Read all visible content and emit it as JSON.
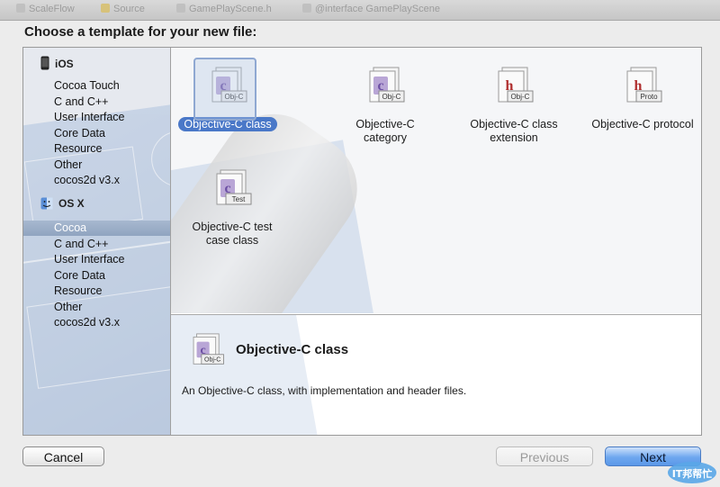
{
  "window": {
    "background_tabs": [
      "ScaleFlow",
      "Source",
      "GamePlayScene.h",
      "@interface GamePlayScene"
    ]
  },
  "heading": "Choose a template for your new file:",
  "sidebar": {
    "sections": [
      {
        "title": "iOS",
        "icon": "iphone-icon",
        "items": [
          "Cocoa Touch",
          "C and C++",
          "User Interface",
          "Core Data",
          "Resource",
          "Other",
          "cocos2d v3.x"
        ]
      },
      {
        "title": "OS X",
        "icon": "finder-icon",
        "items": [
          "Cocoa",
          "C and C++",
          "User Interface",
          "Core Data",
          "Resource",
          "Other",
          "cocos2d v3.x"
        ]
      }
    ],
    "selected": "OS X / Cocoa"
  },
  "templates": [
    {
      "label": "Objective-C class",
      "badge": "Obj-C",
      "glyph": "c",
      "selected": true
    },
    {
      "label": "Objective-C category",
      "badge": "Obj-C",
      "glyph": "c"
    },
    {
      "label": "Objective-C class extension",
      "badge": "Obj-C",
      "glyph": "h"
    },
    {
      "label": "Objective-C protocol",
      "badge": "Proto",
      "glyph": "h"
    },
    {
      "label": "Objective-C test case class",
      "badge": "Test",
      "glyph": "c"
    }
  ],
  "detail": {
    "title": "Objective-C class",
    "badge": "Obj-C",
    "description": "An Objective-C class, with implementation and header files."
  },
  "buttons": {
    "cancel": "Cancel",
    "previous": "Previous",
    "next": "Next"
  },
  "watermark": {
    "text": "IT邦帮忙"
  },
  "colors": {
    "selection": "#4a78c8",
    "sidebar_selection": "#98abc6",
    "primary_button": "#6ea7ef"
  }
}
